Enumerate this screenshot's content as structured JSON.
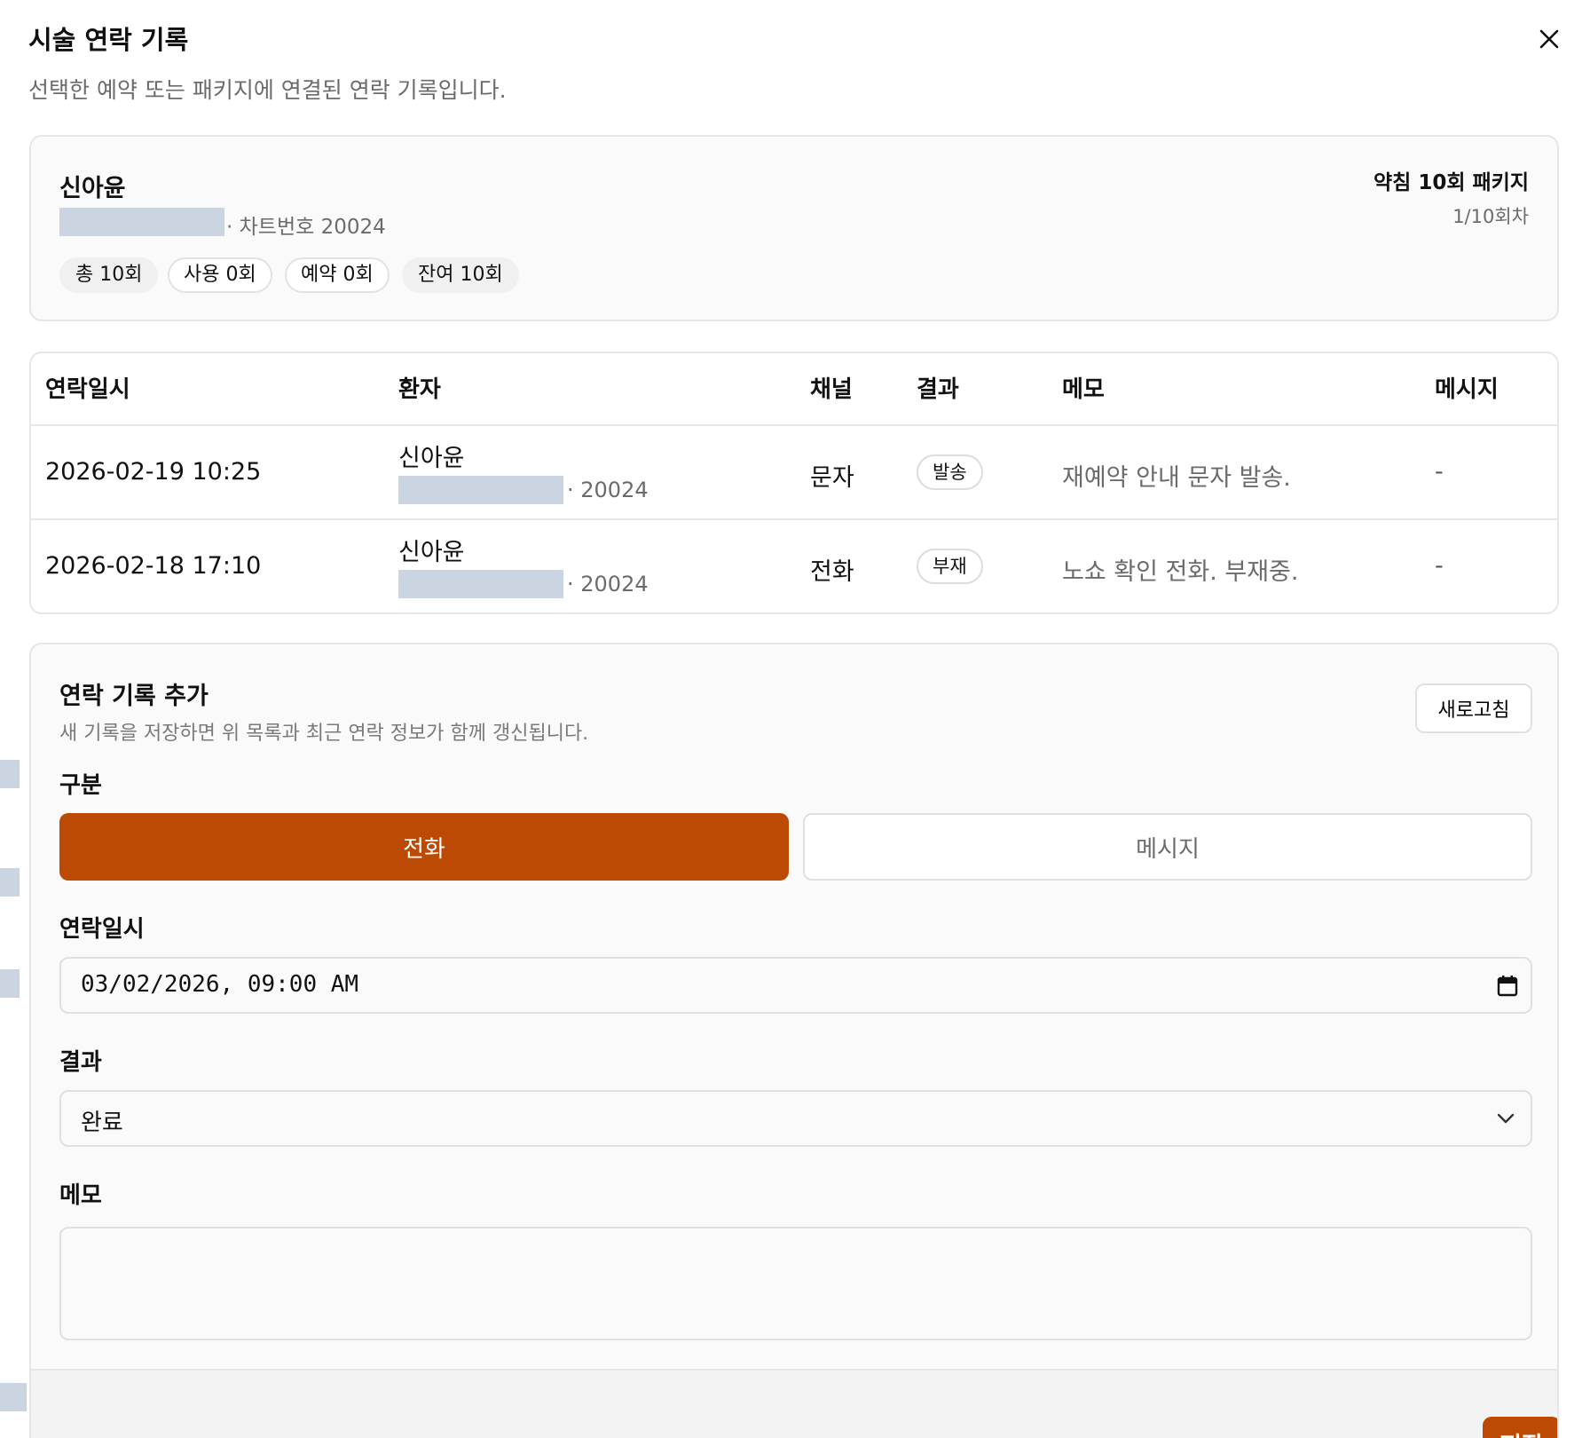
{
  "dialog": {
    "title": "시술 연락 기록",
    "subtitle": "선택한 예약 또는 패키지에 연결된 연락 기록입니다."
  },
  "patient": {
    "name": "신아윤",
    "chart_line": "· 차트번호 20024",
    "package_name": "약침 10회 패키지",
    "round": "1/10회차",
    "chips": [
      "총 10회",
      "사용 0회",
      "예약 0회",
      "잔여 10회"
    ]
  },
  "table": {
    "headers": [
      "연락일시",
      "환자",
      "채널",
      "결과",
      "메모",
      "메시지"
    ],
    "rows": [
      {
        "datetime": "2026-02-19 10:25",
        "patient": "신아윤",
        "chart": "· 20024",
        "channel": "문자",
        "result": "발송",
        "memo": "재예약 안내 문자 발송.",
        "message": "-"
      },
      {
        "datetime": "2026-02-18 17:10",
        "patient": "신아윤",
        "chart": "· 20024",
        "channel": "전화",
        "result": "부재",
        "memo": "노쇼 확인 전화. 부재중.",
        "message": "-"
      }
    ]
  },
  "form": {
    "title": "연락 기록 추가",
    "description": "새 기록을 저장하면 위 목록과 최근 연락 정보가 함께 갱신됩니다.",
    "refresh_label": "새로고침",
    "type_label": "구분",
    "type_options": [
      "전화",
      "메시지"
    ],
    "datetime_label": "연락일시",
    "datetime_value": "03/02/2026, 09:00 AM",
    "result_label": "결과",
    "result_value": "완료",
    "memo_label": "메모",
    "memo_value": "",
    "save_label": "저장"
  },
  "colors": {
    "accent": "#bd4a04",
    "redaction": "#cbd5e1"
  }
}
